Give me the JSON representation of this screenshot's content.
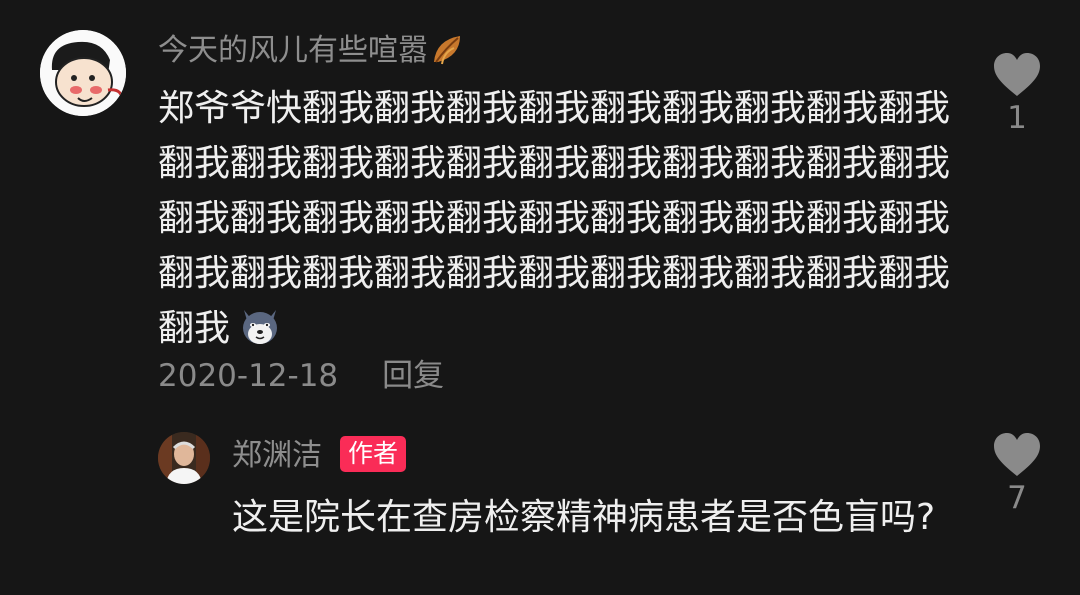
{
  "comment": {
    "username": "今天的风儿有些喧嚣",
    "username_emoji": "leaf-icon",
    "text": "郑爷爷快翻我翻我翻我翻我翻我翻我翻我翻我翻我翻我翻我翻我翻我翻我翻我翻我翻我翻我翻我翻我翻我翻我翻我翻我翻我翻我翻我翻我翻我翻我翻我翻我翻我翻我翻我翻我翻我翻我翻我翻我翻我翻我翻我",
    "text_emoji": "wolf-emoji",
    "date": "2020-12-18",
    "reply_label": "回复",
    "like_count": "1"
  },
  "reply": {
    "username": "郑渊洁",
    "badge": "作者",
    "text": "这是院长在查房检察精神病患者是否色盲吗?",
    "like_count": "7"
  },
  "colors": {
    "background": "#161616",
    "secondary_text": "#8a8a8a",
    "primary_text": "#efefef",
    "badge": "#fa2c57",
    "heart": "#8a8a8a"
  }
}
